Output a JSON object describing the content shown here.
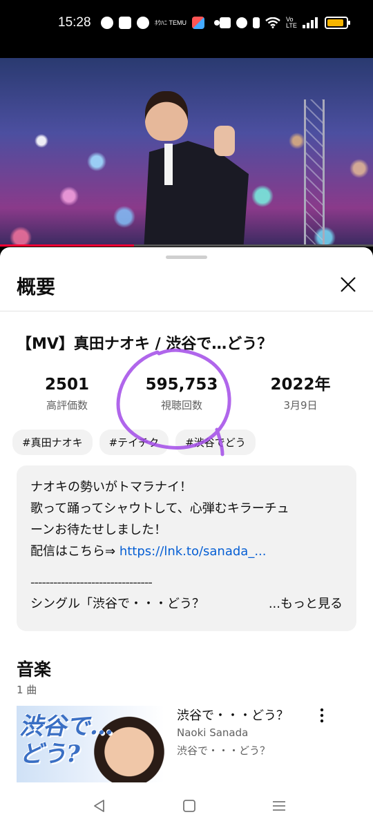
{
  "status_bar": {
    "time": "15:28",
    "left_icons": [
      "facebook-icon",
      "youtube-icon",
      "pinterest-icon",
      "temu-icon",
      "multi-app-icon",
      "notification-dot-icon"
    ],
    "temu_label": "ﾎｳﾊﾆ TEMU",
    "right_icons": [
      "nfc-icon",
      "alarm-icon",
      "bluetooth-icon",
      "wifi-icon",
      "volte-icon",
      "signal-icon",
      "battery-icon"
    ],
    "volte_label": "Vo LTE",
    "battery_color": "#f5b400"
  },
  "player": {
    "progress_fraction": 0.36,
    "progress_color": "#ff0033"
  },
  "sheet": {
    "title": "概要",
    "video_title": "【MV】真田ナオキ / 渋谷で…どう？",
    "stats": [
      {
        "value": "2501",
        "label": "高評価数"
      },
      {
        "value": "595,753",
        "label": "視聴回数"
      },
      {
        "value": "2022年",
        "label": "3月9日"
      }
    ],
    "annotation_color": "#a24be8",
    "hashtags": [
      "#真田ナオキ",
      "#テイチク",
      "#渋谷でどう"
    ],
    "description": {
      "line1": "ナオキの勢いがトマラナイ！",
      "line2": "歌って踊ってシャウトして、心弾むキラーチュ",
      "line3": "ーンお待たせしました！",
      "line4_prefix": "配信はこちら⇒ ",
      "line4_link": "https://lnk.to/sanada_...",
      "rule": "--------------------------------",
      "line5": "シングル「渋谷で・・・どう？",
      "more": "...もっと見る"
    },
    "music": {
      "title": "音楽",
      "count": "1 曲",
      "art_text_line1": "渋谷で…",
      "art_text_line2": "どう?",
      "track_name": "渋谷で・・・どう？",
      "track_artist": "Naoki Sanada",
      "track_album": "渋谷で・・・どう？"
    }
  },
  "nav": {
    "icons": [
      "back-icon",
      "home-icon",
      "recents-icon"
    ]
  }
}
